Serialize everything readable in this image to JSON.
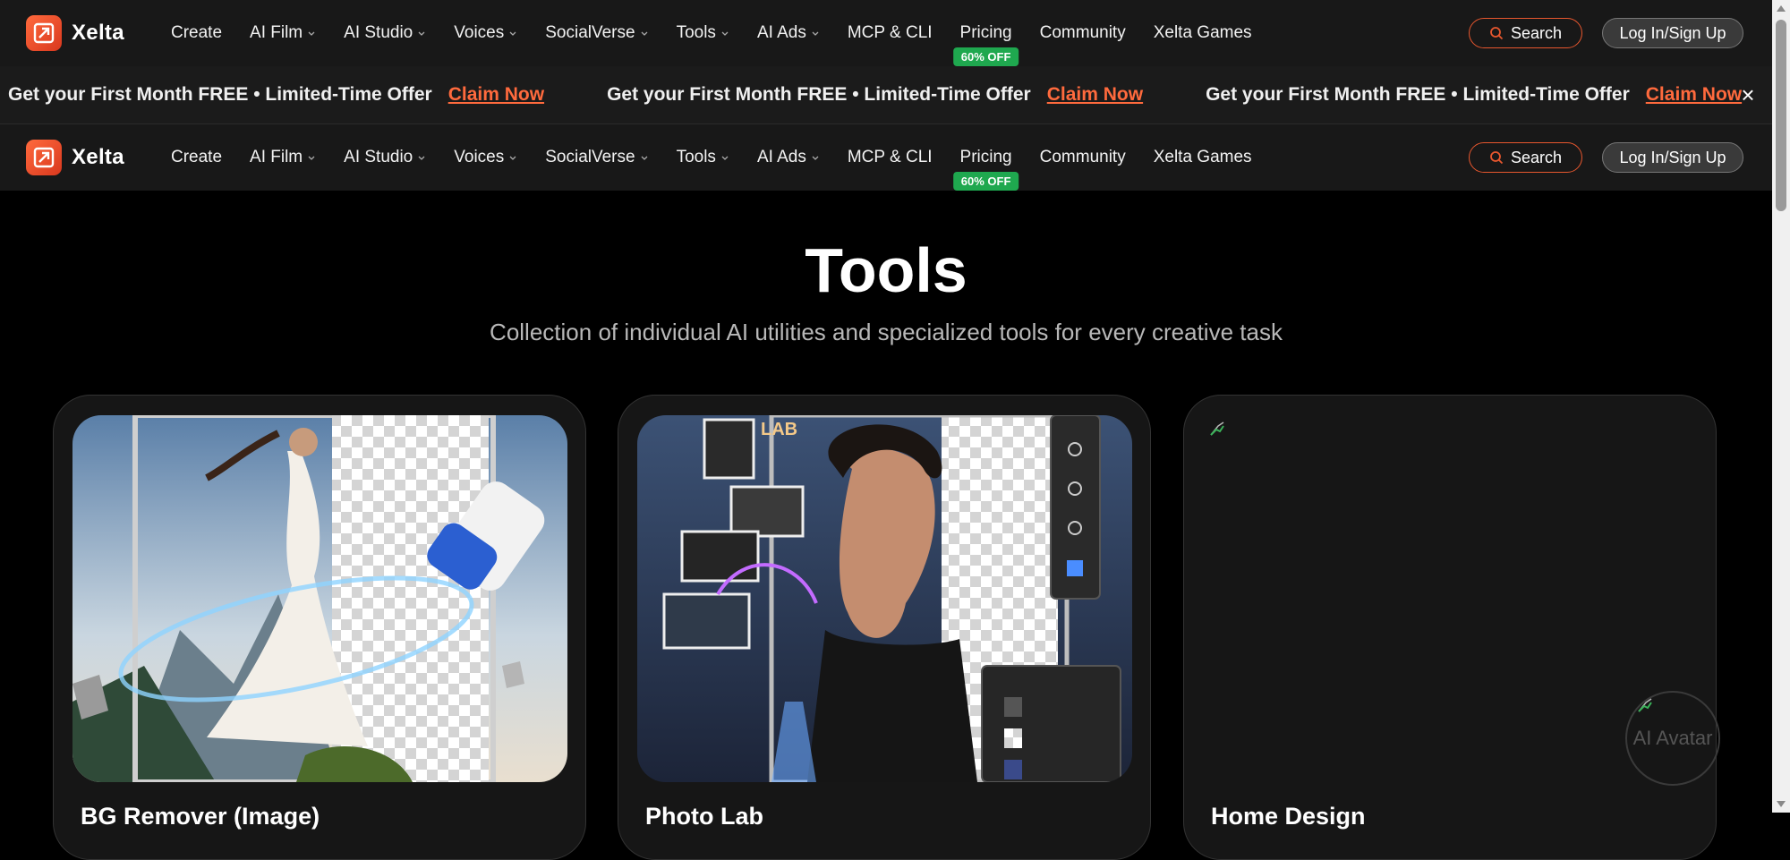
{
  "brand": {
    "name": "Xelta",
    "accent_color": "#e8572e",
    "badge_color": "#1fa84f"
  },
  "nav": {
    "items": [
      {
        "label": "Create",
        "has_dropdown": false
      },
      {
        "label": "AI Film",
        "has_dropdown": true
      },
      {
        "label": "AI Studio",
        "has_dropdown": true
      },
      {
        "label": "Voices",
        "has_dropdown": true
      },
      {
        "label": "SocialVerse",
        "has_dropdown": true
      },
      {
        "label": "Tools",
        "has_dropdown": true
      },
      {
        "label": "AI Ads",
        "has_dropdown": true
      },
      {
        "label": "MCP & CLI",
        "has_dropdown": false
      },
      {
        "label": "Pricing",
        "has_dropdown": false,
        "badge": "60% OFF"
      },
      {
        "label": "Community",
        "has_dropdown": false
      },
      {
        "label": "Xelta Games",
        "has_dropdown": false
      }
    ],
    "search_label": "Search",
    "login_label": "Log In/Sign Up"
  },
  "promo": {
    "text": "Get your First Month FREE • Limited-Time Offer",
    "link_label": "Claim Now",
    "close_symbol": "×"
  },
  "hero": {
    "title": "Tools",
    "subtitle": "Collection of individual AI utilities and specialized tools for every creative task"
  },
  "cards": [
    {
      "title": "BG Remover (Image)",
      "image": "woman-eraser-transparent-bg"
    },
    {
      "title": "Photo Lab",
      "image": "woman-dissolving-photo-editor"
    },
    {
      "title": "Home Design",
      "image": "broken-image"
    }
  ],
  "floating": {
    "avatar_label": "AI Avatar"
  }
}
